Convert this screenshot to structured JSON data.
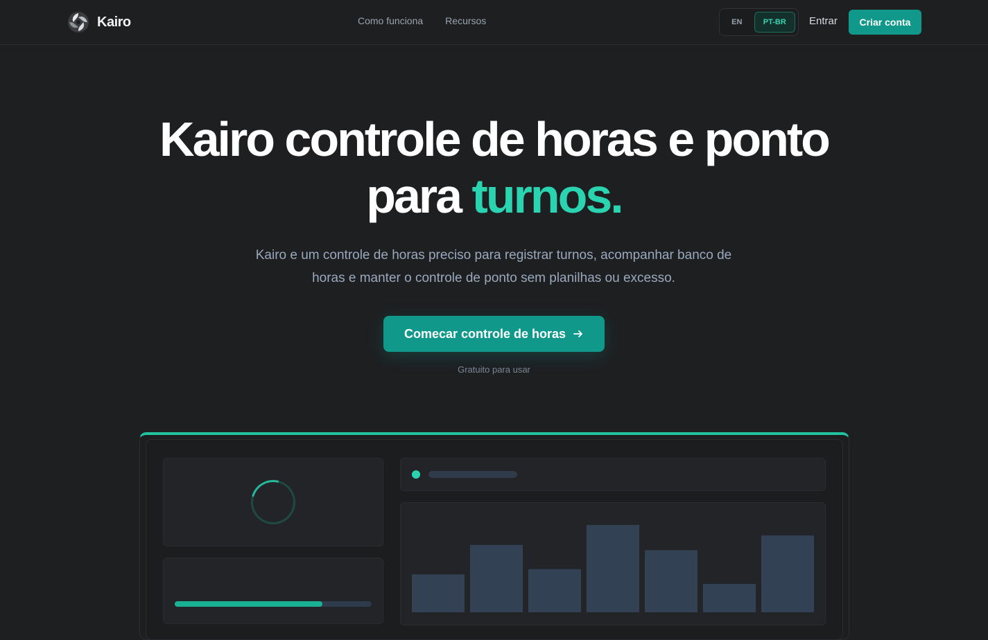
{
  "navbar": {
    "brand": "Kairo",
    "links": [
      "Como funciona",
      "Recursos"
    ],
    "lang": {
      "en": "EN",
      "pt": "PT-BR",
      "active": "PT-BR"
    },
    "login": "Entrar",
    "signup": "Criar conta"
  },
  "hero": {
    "title_main": "Kairo controle de horas e ponto",
    "title_pre": "para",
    "title_accent": "turnos.",
    "description": "Kairo e um controle de horas preciso para registrar turnos, acompanhar banco de horas e manter o controle de ponto sem planilhas ou excesso.",
    "cta": "Comecar controle de horas",
    "cta_note": "Gratuito para usar"
  },
  "preview": {
    "progress": 0.75,
    "bar_levels": [
      0.36,
      0.64,
      0.41,
      0.83,
      0.59,
      0.27,
      0.73
    ]
  },
  "colors": {
    "accent": "#2ad4b0",
    "button": "#10998a",
    "background": "#1e1f21",
    "bar": "#334155"
  }
}
